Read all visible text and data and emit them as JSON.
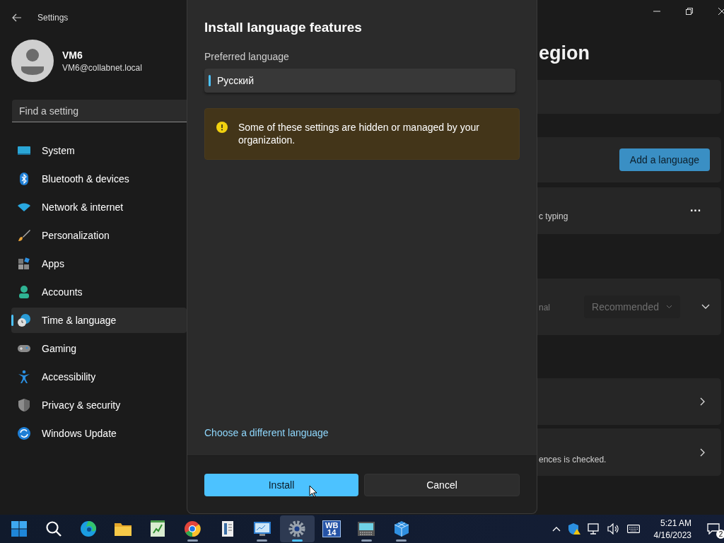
{
  "window": {
    "title": "Settings"
  },
  "user": {
    "name": "VM6",
    "email": "VM6@collabnet.local"
  },
  "search": {
    "placeholder": "Find a setting"
  },
  "sidebar": {
    "items": [
      {
        "kind": "system",
        "label": "System",
        "selected": false
      },
      {
        "kind": "bluetooth",
        "label": "Bluetooth & devices",
        "selected": false
      },
      {
        "kind": "network",
        "label": "Network & internet",
        "selected": false
      },
      {
        "kind": "personalization",
        "label": "Personalization",
        "selected": false
      },
      {
        "kind": "apps",
        "label": "Apps",
        "selected": false
      },
      {
        "kind": "accounts",
        "label": "Accounts",
        "selected": false
      },
      {
        "kind": "time",
        "label": "Time & language",
        "selected": true
      },
      {
        "kind": "gaming",
        "label": "Gaming",
        "selected": false
      },
      {
        "kind": "accessibility",
        "label": "Accessibility",
        "selected": false
      },
      {
        "kind": "privacy",
        "label": "Privacy & security",
        "selected": false
      },
      {
        "kind": "update",
        "label": "Windows Update",
        "selected": false
      }
    ]
  },
  "page": {
    "title": "egion",
    "add_button": "Add a language",
    "language_row": {
      "detail": "c typing",
      "more": "···"
    },
    "region_row": {
      "detail": "nal",
      "dropdown": "Recommended",
      "disabled": true
    },
    "last_row": {
      "detail": "ences is checked."
    }
  },
  "dialog": {
    "title": "Install language features",
    "field_label": "Preferred language",
    "value": "Русский",
    "warning": "Some of these settings are hidden or managed by your organization.",
    "link": "Choose a different language",
    "buttons": [
      {
        "kind": "primary",
        "label": "Install"
      },
      {
        "kind": "secondary",
        "label": "Cancel"
      }
    ]
  },
  "taskbar": {
    "apps": [
      {
        "kind": "start",
        "running": false,
        "selected": false
      },
      {
        "kind": "search",
        "running": false,
        "selected": false
      },
      {
        "kind": "edge",
        "running": false,
        "selected": false
      },
      {
        "kind": "folder",
        "running": false,
        "selected": false
      },
      {
        "kind": "notepad",
        "running": false,
        "selected": false
      },
      {
        "kind": "chrome",
        "running": true,
        "selected": false
      },
      {
        "kind": "book",
        "running": false,
        "selected": false
      },
      {
        "kind": "monitor",
        "running": true,
        "selected": false
      },
      {
        "kind": "settings",
        "running": true,
        "selected": true
      },
      {
        "kind": "tile",
        "label": "WB 14",
        "running": false,
        "selected": false
      },
      {
        "kind": "keyboard",
        "running": true,
        "selected": false
      },
      {
        "kind": "cubes",
        "running": true,
        "selected": false
      }
    ],
    "time": "5:21 AM",
    "date": "4/16/2023",
    "notifications": "2"
  }
}
